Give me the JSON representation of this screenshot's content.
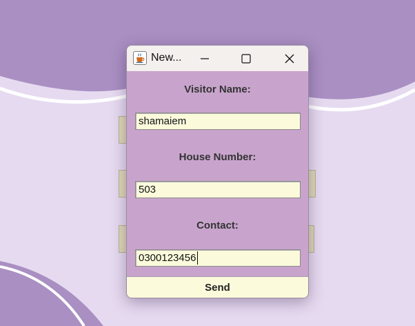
{
  "window": {
    "title": "New...",
    "icon": "java-cup-icon"
  },
  "controls": {
    "minimize_icon": "minimize-icon",
    "maximize_icon": "maximize-icon",
    "close_icon": "close-icon"
  },
  "form": {
    "visitor_name_label": "Visitor Name:",
    "visitor_name_value": "shamaiem",
    "house_number_label": "House Number:",
    "house_number_value": "503",
    "contact_label": "Contact:",
    "contact_value": "0300123456",
    "send_label": "Send"
  },
  "colors": {
    "desktop_background": "#e6daf0",
    "wave_dark": "#a98fc2",
    "window_body": "#c8a4cc",
    "field_background": "#fbfbdc"
  }
}
